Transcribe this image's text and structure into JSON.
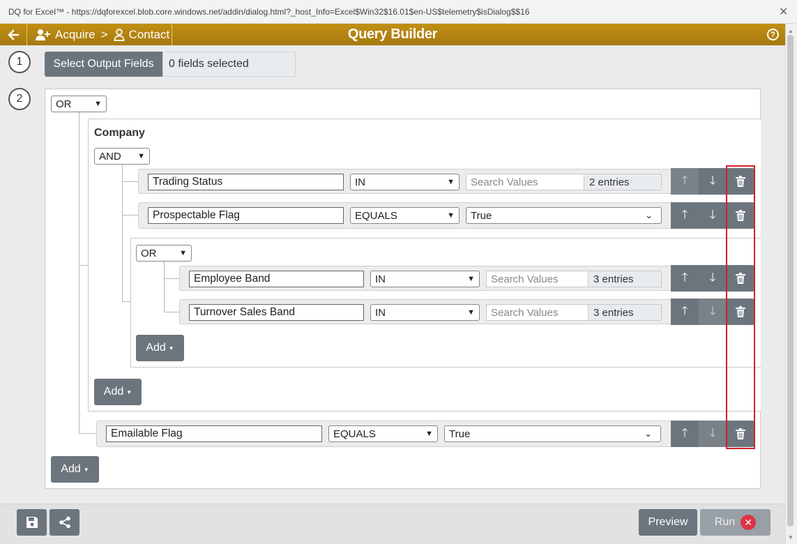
{
  "window": {
    "title": "DQ for Excel™ - https://dqforexcel.blob.core.windows.net/addin/dialog.html?_host_Info=Excel$Win32$16.01$en-US$telemetry$isDialog$$16",
    "close": "✕"
  },
  "header": {
    "title": "Query Builder",
    "breadcrumb": [
      "Acquire",
      ">",
      "Contact"
    ],
    "help": "?"
  },
  "steps": {
    "one": "1",
    "two": "2"
  },
  "output": {
    "button": "Select Output Fields",
    "value": "0 fields selected"
  },
  "root": {
    "operator": "OR",
    "group": {
      "title": "Company",
      "operator": "AND",
      "rules": [
        {
          "field": "Trading Status",
          "op": "IN",
          "search_placeholder": "Search Values",
          "entries": "2 entries"
        },
        {
          "field": "Prospectable Flag",
          "op": "EQUALS",
          "value": "True"
        }
      ],
      "subgroup": {
        "operator": "OR",
        "rules": [
          {
            "field": "Employee Band",
            "op": "IN",
            "search_placeholder": "Search Values",
            "entries": "3 entries"
          },
          {
            "field": "Turnover Sales Band",
            "op": "IN",
            "search_placeholder": "Search Values",
            "entries": "3 entries"
          }
        ],
        "add": "Add"
      },
      "add": "Add"
    },
    "rule": {
      "field": "Emailable Flag",
      "op": "EQUALS",
      "value": "True"
    },
    "add": "Add"
  },
  "footer": {
    "preview": "Preview",
    "run": "Run"
  },
  "icons": [
    "back-arrow-icon",
    "add-user-icon",
    "user-icon",
    "help-icon",
    "arrow-up-icon",
    "arrow-down-icon",
    "trash-icon",
    "save-icon",
    "share-icon",
    "close-circle-icon"
  ],
  "colors": {
    "header": "#b8860b",
    "button": "#6c757d",
    "highlight": "#d0202a",
    "run_close": "#dc3545"
  }
}
